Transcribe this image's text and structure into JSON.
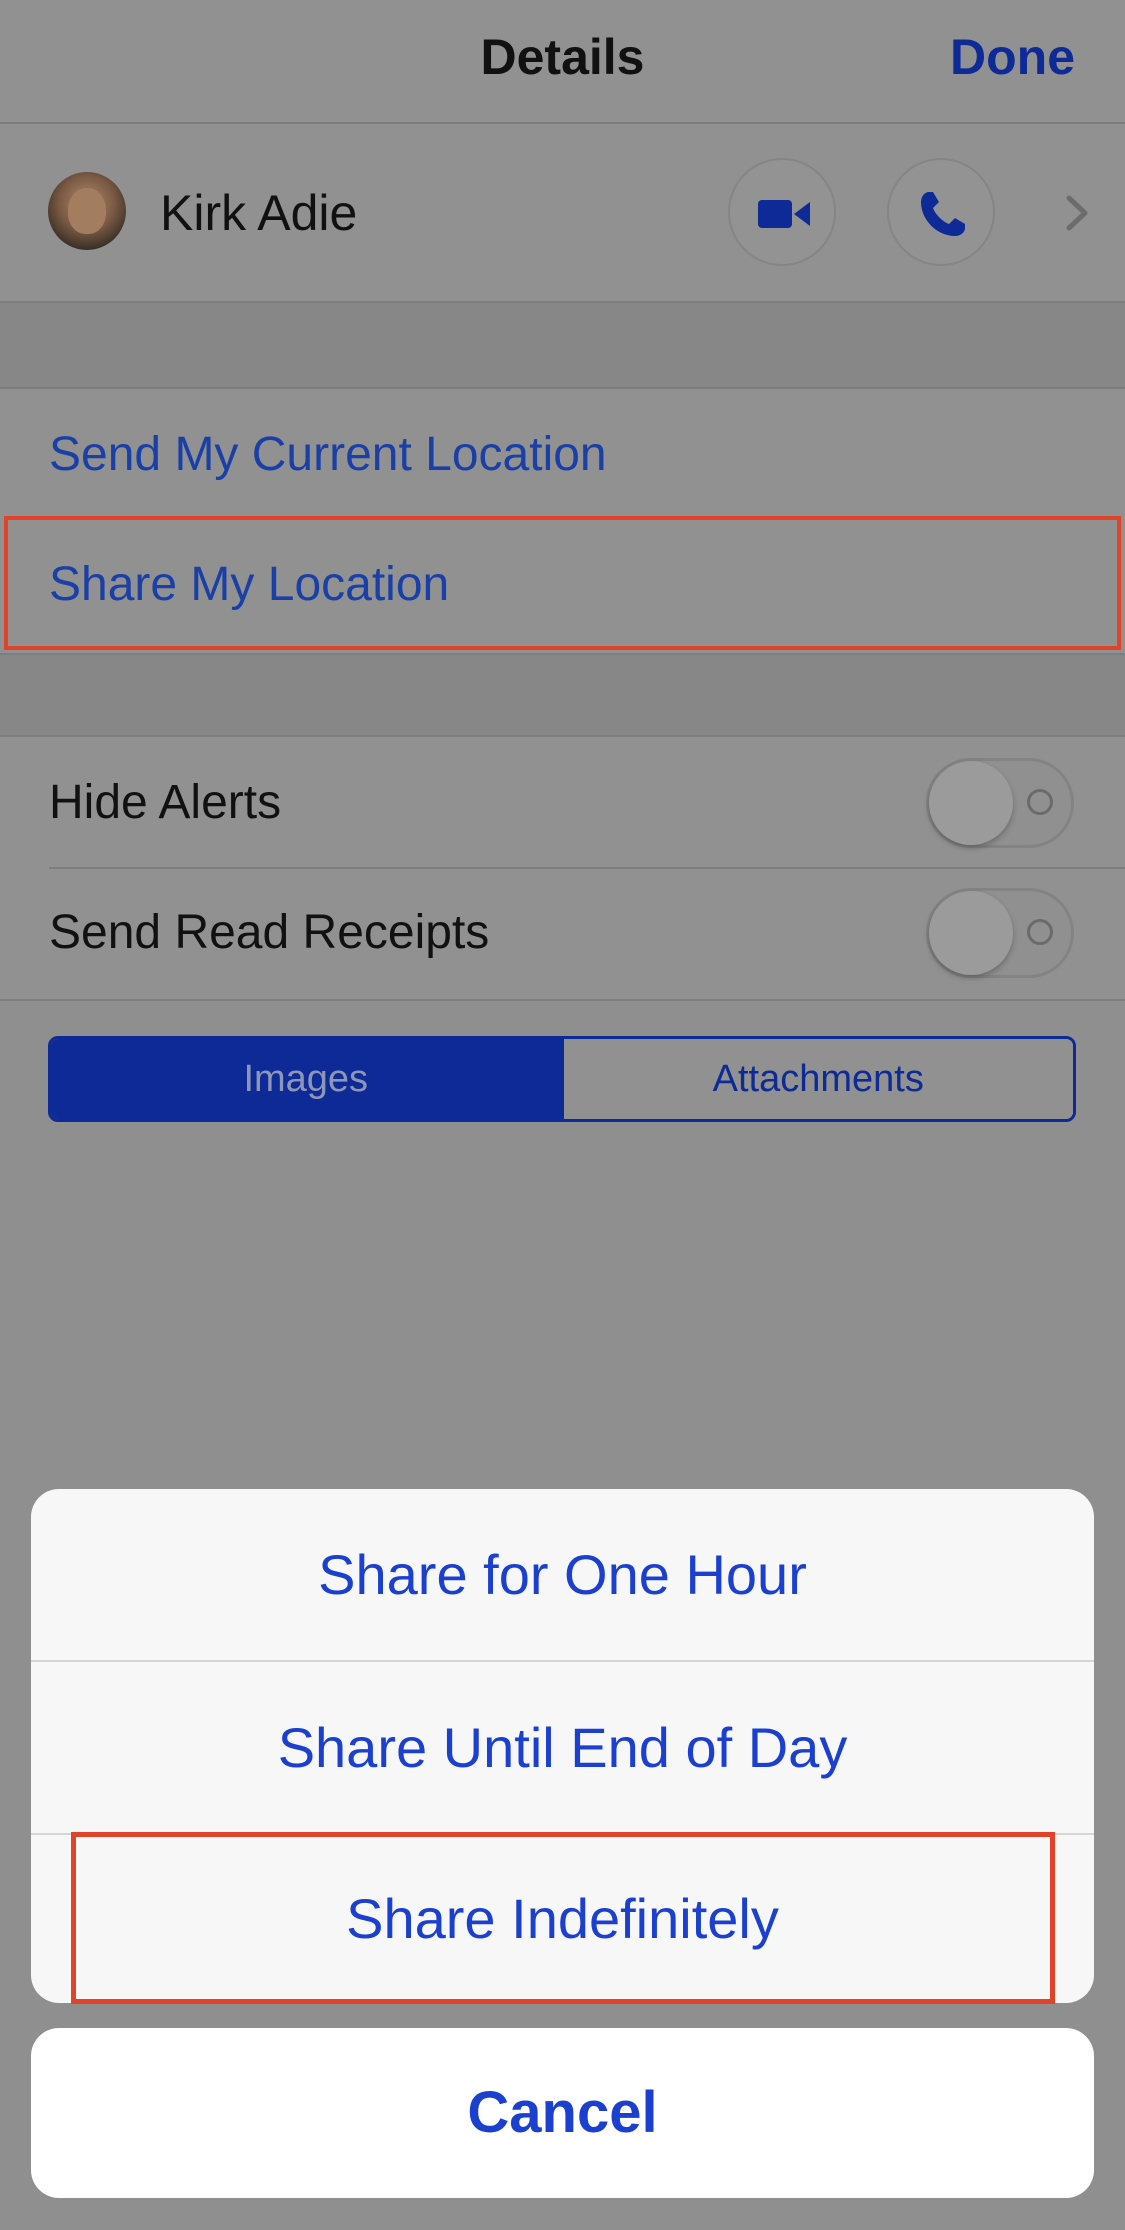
{
  "navbar": {
    "title": "Details",
    "done_label": "Done"
  },
  "contact": {
    "name": "Kirk Adie",
    "video_icon": "video-camera-icon",
    "phone_icon": "phone-icon",
    "chevron_icon": "chevron-right-icon"
  },
  "location": {
    "send_current": "Send My Current Location",
    "share_my": "Share My Location"
  },
  "settings": {
    "hide_alerts_label": "Hide Alerts",
    "hide_alerts_on": false,
    "read_receipts_label": "Send Read Receipts",
    "read_receipts_on": false
  },
  "segmented": {
    "options": [
      "Images",
      "Attachments"
    ],
    "selected": "Images"
  },
  "action_sheet": {
    "items": [
      "Share for One Hour",
      "Share Until End of Day",
      "Share Indefinitely"
    ],
    "cancel_label": "Cancel"
  },
  "colors": {
    "accent": "#0d2a96",
    "sheet_text": "#1b3fcf",
    "highlight": "#e0432a"
  }
}
